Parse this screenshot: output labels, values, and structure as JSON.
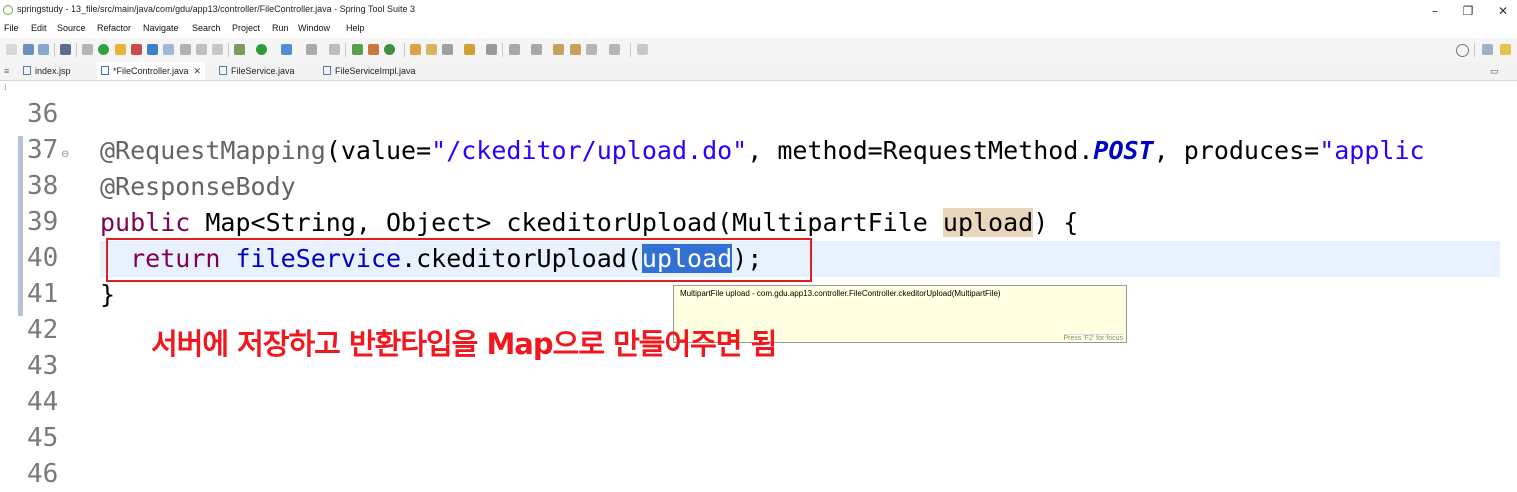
{
  "window": {
    "title": "springstudy - 13_file/src/main/java/com/gdu/app13/controller/FileController.java - Spring Tool Suite 3",
    "minimize": "–",
    "restore": "❐",
    "close": "✕"
  },
  "menu": {
    "items": [
      "File",
      "Edit",
      "Source",
      "Refactor",
      "Navigate",
      "Search",
      "Project",
      "Run",
      "Window",
      "Help"
    ]
  },
  "toolbar": {
    "search_icon": "search-icon",
    "perspective_icon": "perspective-icon"
  },
  "tabs": [
    {
      "label": "index.jsp",
      "active": false
    },
    {
      "label": "*FileController.java",
      "active": true,
      "close": "✕"
    },
    {
      "label": "FileService.java",
      "active": false
    },
    {
      "label": "FileServiceImpl.java",
      "active": false
    }
  ],
  "editor": {
    "lines": [
      {
        "num": "36"
      },
      {
        "num": "37"
      },
      {
        "num": "38"
      },
      {
        "num": "39"
      },
      {
        "num": "40"
      },
      {
        "num": "41"
      },
      {
        "num": "42"
      },
      {
        "num": "43"
      },
      {
        "num": "44"
      },
      {
        "num": "45"
      },
      {
        "num": "46"
      }
    ],
    "code": {
      "l37_ann": "@RequestMapping",
      "l37_a": "(value=",
      "l37_str1": "\"/ckeditor/upload.do\"",
      "l37_b": ", method=RequestMethod.",
      "l37_const": "POST",
      "l37_c": ", produces=",
      "l37_str2": "\"applic",
      "l38_ann": "@ResponseBody",
      "l39_kw": "public",
      "l39_a": " Map<String, Object> ckeditorUpload(MultipartFile ",
      "l39_param": "upload",
      "l39_b": ") {",
      "l40_indent": "  ",
      "l40_kw": "return",
      "l40_sp": " ",
      "l40_field": "fileService",
      "l40_a": ".ckeditorUpload(",
      "l40_sel": "upload",
      "l40_b": ");",
      "l41": "}"
    }
  },
  "tooltip": {
    "text": "MultipartFile upload - com.gdu.app13.controller.FileController.ckeditorUpload(MultipartFile)",
    "footer": "Press 'F2' for focus"
  },
  "overlay": {
    "korean_note": "서버에 저장하고 반환타입을 Map으로 만들어주면 됨"
  },
  "colors": {
    "keyword": "#7f0055",
    "string": "#2a00ff",
    "annotation": "#646464",
    "selection": "#3370d4",
    "highlight_box": "#e0201e",
    "overlay_text": "#f0181e"
  }
}
